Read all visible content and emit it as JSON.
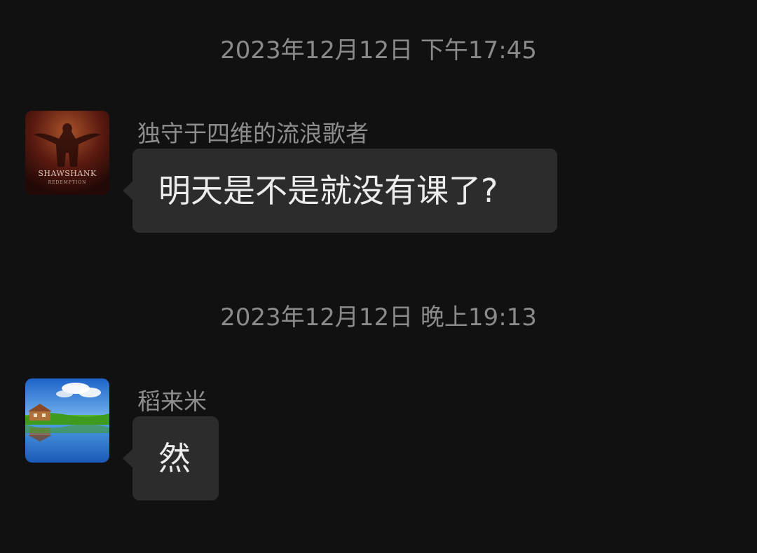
{
  "conversation": {
    "timestamps": [
      "2023年12月12日 下午17:45",
      "2023年12月12日 晚上19:13"
    ],
    "messages": [
      {
        "sender": "独守于四维的流浪歌者",
        "text": "明天是不是就没有课了?",
        "avatar_icon": "shawshank-poster-avatar",
        "avatar_text": [
          "SHAWSHANK",
          "REDEMPTION"
        ]
      },
      {
        "sender": "稻来米",
        "text": "然",
        "avatar_icon": "landscape-house-avatar"
      }
    ]
  },
  "colors": {
    "background": "#111111",
    "bubble": "#2c2c2c",
    "timestamp": "#8a8a8a",
    "sender": "#8d8d8d",
    "message_text": "#ececec"
  }
}
